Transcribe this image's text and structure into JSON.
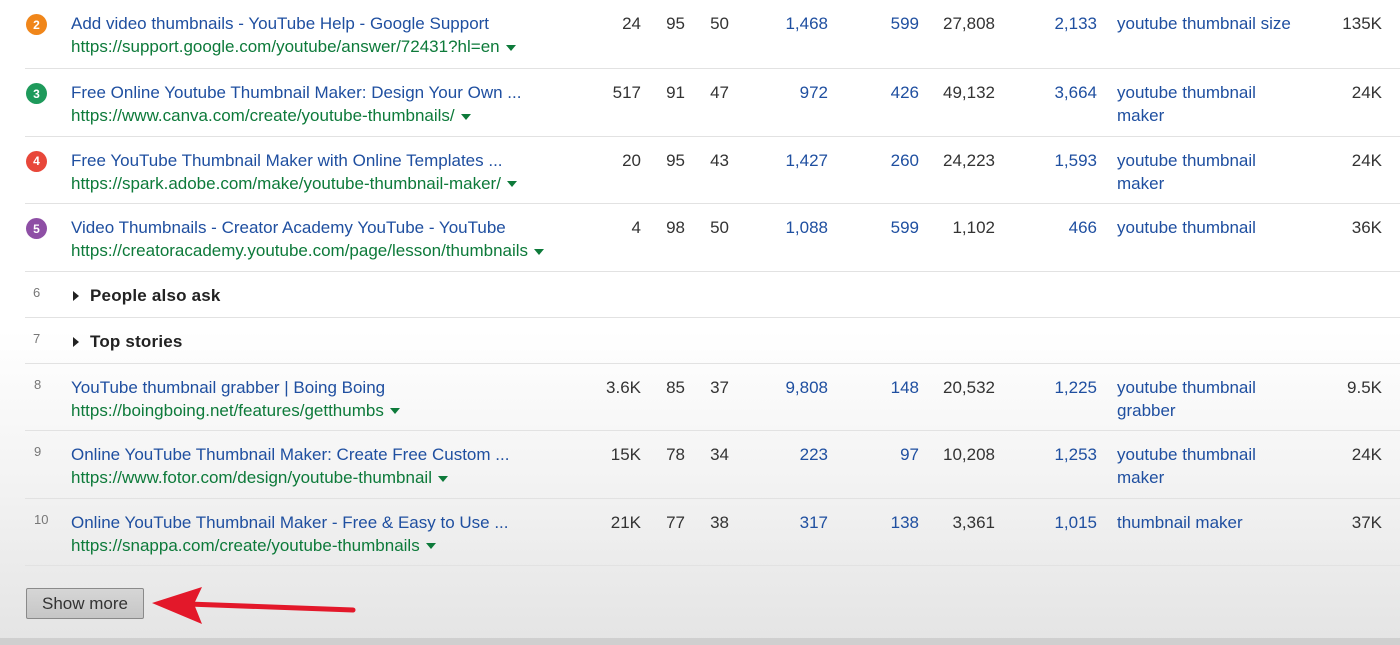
{
  "results": [
    {
      "position": "2",
      "badge_color": "#f0861a",
      "title": "Add video thumbnails - YouTube Help - Google Support",
      "url": "https://support.google.com/youtube/answer/72431?hl=en",
      "metrics": [
        "24",
        "95",
        "50",
        "1,468",
        "599",
        "27,808",
        "2,133"
      ],
      "keyword": "youtube thumbnail size",
      "traffic": "135K"
    },
    {
      "position": "3",
      "badge_color": "#1e9a5b",
      "title": "Free Online Youtube Thumbnail Maker: Design Your Own ...",
      "url": "https://www.canva.com/create/youtube-thumbnails/",
      "metrics": [
        "517",
        "91",
        "47",
        "972",
        "426",
        "49,132",
        "3,664"
      ],
      "keyword": "youtube thumbnail maker",
      "traffic": "24K"
    },
    {
      "position": "4",
      "badge_color": "#e8473a",
      "title": "Free YouTube Thumbnail Maker with Online Templates ...",
      "url": "https://spark.adobe.com/make/youtube-thumbnail-maker/",
      "metrics": [
        "20",
        "95",
        "43",
        "1,427",
        "260",
        "24,223",
        "1,593"
      ],
      "keyword": "youtube thumbnail maker",
      "traffic": "24K"
    },
    {
      "position": "5",
      "badge_color": "#8e4fa5",
      "title": "Video Thumbnails - Creator Academy YouTube - YouTube",
      "url": "https://creatoracademy.youtube.com/page/lesson/thumbnails",
      "metrics": [
        "4",
        "98",
        "50",
        "1,088",
        "599",
        "1,102",
        "466"
      ],
      "keyword": "youtube thumbnail",
      "traffic": "36K"
    }
  ],
  "features": [
    {
      "position": "6",
      "label": "People also ask"
    },
    {
      "position": "7",
      "label": "Top stories"
    }
  ],
  "results2": [
    {
      "position": "8",
      "title": "YouTube thumbnail grabber | Boing Boing",
      "url": "https://boingboing.net/features/getthumbs",
      "metrics": [
        "3.6K",
        "85",
        "37",
        "9,808",
        "148",
        "20,532",
        "1,225"
      ],
      "keyword": "youtube thumbnail grabber",
      "traffic": "9.5K"
    },
    {
      "position": "9",
      "title": "Online YouTube Thumbnail Maker: Create Free Custom ...",
      "url": "https://www.fotor.com/design/youtube-thumbnail",
      "metrics": [
        "15K",
        "78",
        "34",
        "223",
        "97",
        "10,208",
        "1,253"
      ],
      "keyword": "youtube thumbnail maker",
      "traffic": "24K"
    },
    {
      "position": "10",
      "title": "Online YouTube Thumbnail Maker - Free & Easy to Use ...",
      "url": "https://snappa.com/create/youtube-thumbnails",
      "metrics": [
        "21K",
        "77",
        "38",
        "317",
        "138",
        "3,361",
        "1,015"
      ],
      "keyword": "thumbnail maker",
      "traffic": "37K"
    }
  ],
  "show_more_label": "Show more",
  "colors": {
    "link": "#1f4fa0",
    "url": "#0d7a3a",
    "arrow": "#e3182a"
  }
}
